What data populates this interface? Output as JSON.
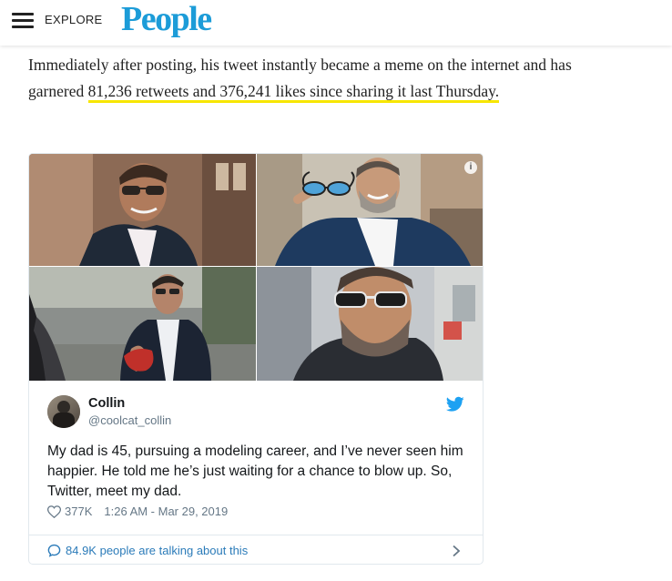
{
  "header": {
    "explore_label": "EXPLORE",
    "logo_text": "People",
    "logo_color": "#1c9cd8"
  },
  "article": {
    "text_before": "Immediately after posting, his tweet instantly became a meme on the internet and has garnered ",
    "link_text": "81,236 retweets and 376,241 likes since sharing it last Thursday.",
    "link_underline_color": "#f7e600"
  },
  "tweet": {
    "info_label": "i",
    "name": "Collin",
    "handle": "@coolcat_collin",
    "text": "My dad is 45, pursuing a modeling career, and I’ve never seen him happier. He told me he’s just waiting for a chance to blow up. So, Twitter, meet my dad.",
    "likes": "377K",
    "timestamp": "1:26 AM - Mar 29, 2019",
    "talking": "84.9K people are talking about this",
    "accent_color": "#1da1f2",
    "link_color": "#2b7bb9"
  },
  "icons": {
    "menu": "hamburger-icon",
    "info": "info-icon",
    "twitter": "twitter-bird-icon",
    "like": "heart-icon",
    "reply": "speech-bubble-icon",
    "more": "chevron-right-icon"
  }
}
